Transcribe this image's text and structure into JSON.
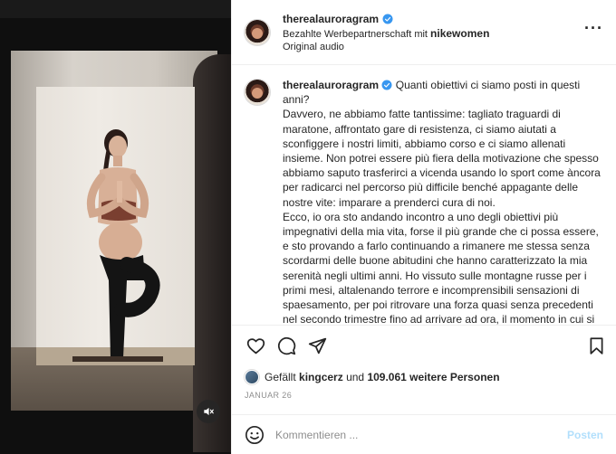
{
  "post": {
    "username": "therealauroragram",
    "partnership_prefix": "Bezahlte Werbepartnerschaft mit",
    "partner": "nikewomen",
    "audio": "Original audio",
    "more_icon": "more-horizontal-icon"
  },
  "caption": {
    "username": "therealauroragram",
    "p1": "Quanti obiettivi ci siamo posti in questi anni?",
    "p2": "Davvero, ne abbiamo fatte tantissime: tagliato traguardi di maratone, affrontato gare di resistenza, ci siamo aiutati a sconfiggere i nostri limiti, abbiamo corso e ci siamo allenati insieme. Non potrei essere più fiera della motivazione che spesso abbiamo saputo trasferirci a vicenda usando lo sport come àncora per radicarci nel percorso più difficile benché appagante delle nostre vite: imparare a prenderci cura di noi.",
    "p3": "Ecco, io ora sto andando incontro a uno degli obiettivi più impegnativi della mia vita, forse il più grande che ci possa essere, e sto provando a farlo continuando a rimanere me stessa senza scordarmi delle buone abitudini che hanno caratterizzato la mia serenità negli ultimi anni. Ho vissuto sulle montagne russe per i primi mesi, altalenando terrore e incomprensibili sensazioni di spaesamento, per poi ritrovare una forza quasi senza precedenti nel secondo trimestre fino ad arrivare ad ora, il momento in cui si è più vicini che mai al traguardo ma che ancora si fa fatica a"
  },
  "actions": {
    "like_icon": "heart-icon",
    "comment_icon": "comment-icon",
    "share_icon": "share-icon",
    "save_icon": "bookmark-icon"
  },
  "likes": {
    "prefix": "Gefällt",
    "user": "kingcerz",
    "middle": "und",
    "count": "109.061 weitere Personen"
  },
  "date": "JANUAR 26",
  "comment": {
    "placeholder": "Kommentieren ...",
    "post_label": "Posten",
    "emoji_icon": "emoji-icon"
  },
  "media": {
    "mute_icon": "speaker-muted-icon"
  },
  "colors": {
    "verified": "#3897f0",
    "post_disabled": "#b2dffc",
    "muted_text": "#8e8e8e"
  }
}
